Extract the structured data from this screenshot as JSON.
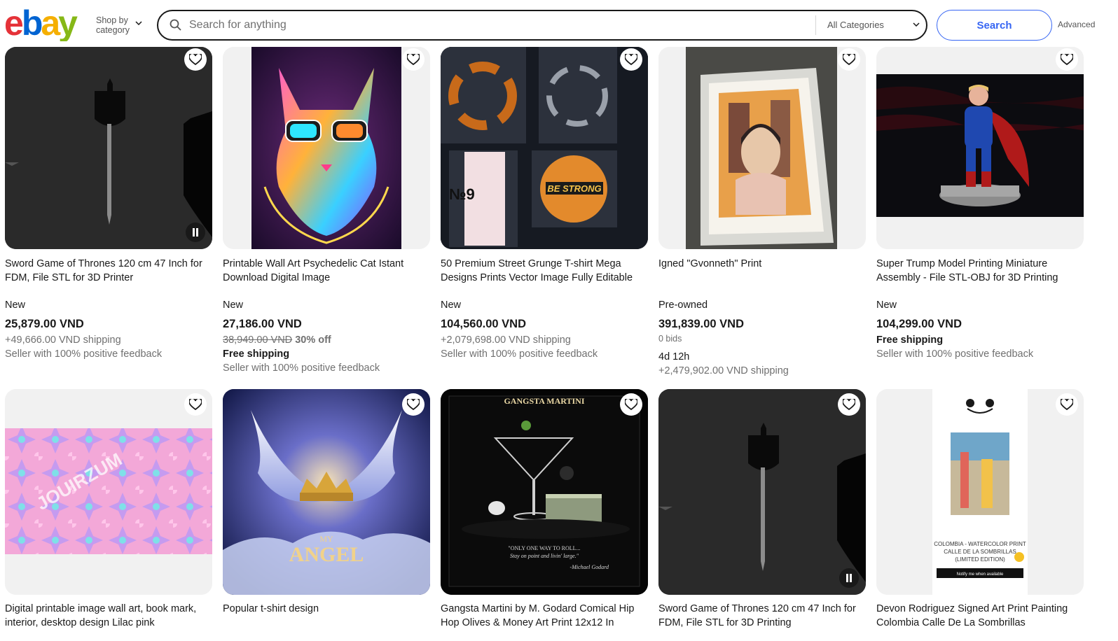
{
  "header": {
    "shop_by_line1": "Shop by",
    "shop_by_line2": "category",
    "search_placeholder": "Search for anything",
    "category_selected": "All Categories",
    "search_button": "Search",
    "advanced": "Advanced"
  },
  "colors": {
    "accent": "#3665f3",
    "text": "#191919",
    "muted": "#707070"
  },
  "listings": [
    {
      "title": "Sword Game of Thrones 120 cm 47 Inch for FDM, File STL for 3D Printer",
      "condition": "New",
      "price": "25,879.00 VND",
      "shipping": "+49,666.00 VND shipping",
      "feedback": "Seller with 100% positive feedback",
      "icon": "video-pause-icon"
    },
    {
      "title": "Printable Wall Art Psychedelic Cat Istant Download Digital Image",
      "condition": "New",
      "price": "27,186.00 VND",
      "original_price": "38,949.00 VND",
      "discount": "30% off",
      "shipping": "Free shipping",
      "feedback": "Seller with 100% positive feedback"
    },
    {
      "title": "50 Premium Street Grunge T-shirt Mega Designs Prints Vector Image Fully Editable",
      "condition": "New",
      "price": "104,560.00 VND",
      "shipping": "+2,079,698.00 VND shipping",
      "feedback": "Seller with 100% positive feedback",
      "art_text": "BE STRONG"
    },
    {
      "title": "Igned \"Gvonneth\" Print",
      "condition": "Pre-owned",
      "price": "391,839.00 VND",
      "bids": "0 bids",
      "time_left": "4d 12h",
      "shipping": "+2,479,902.00 VND shipping"
    },
    {
      "title": "Super Trump Model Printing Miniature Assembly - File STL-OBJ for 3D Printing",
      "condition": "New",
      "price": "104,299.00 VND",
      "shipping": "Free shipping",
      "feedback": "Seller with 100% positive feedback"
    },
    {
      "title": "Digital printable image wall art, book mark, interior, desktop design Lilac pink",
      "art_text": "JOUIRZUM"
    },
    {
      "title": "Popular t-shirt design",
      "art_text": "ANGEL",
      "art_small": "MY"
    },
    {
      "title": "Gangsta Martini by M. Godard Comical Hip Hop Olives & Money Art Print 12x12 In",
      "art_title": "GANGSTA MARTINI",
      "art_quote": "\"ONLY ONE WAY TO ROLL...",
      "art_quote2": "Stay on point and livin' large.\"",
      "art_sign": "-Michael Godard"
    },
    {
      "title": "Sword Game of Thrones 120 cm 47 Inch for FDM, File STL for 3D Printing",
      "icon": "video-pause-icon"
    },
    {
      "title": "Devon Rodriguez Signed Art Print Painting Colombia Calle De La Sombrillas",
      "art_caption1": "COLOMBIA - WATERCOLOR PRINT",
      "art_caption2": "CALLE DE LA SOMBRILLAS",
      "art_caption3": "(LIMITED EDITION)",
      "art_button": "Notify me when available"
    }
  ]
}
